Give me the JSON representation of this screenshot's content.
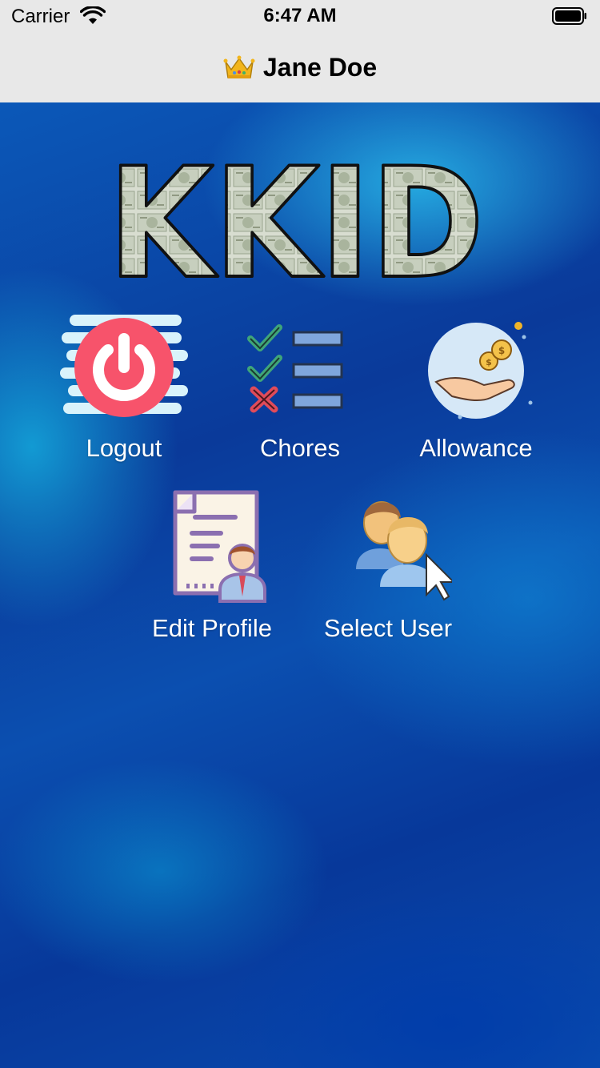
{
  "status_bar": {
    "carrier": "Carrier",
    "time": "6:47 AM"
  },
  "nav": {
    "icon": "crown-icon",
    "title": "Jane Doe"
  },
  "logo": {
    "text": "KKID"
  },
  "menu": [
    {
      "label": "Logout",
      "icon": "power-icon"
    },
    {
      "label": "Chores",
      "icon": "checklist-icon"
    },
    {
      "label": "Allowance",
      "icon": "coins-hand-icon"
    },
    {
      "label": "Edit Profile",
      "icon": "profile-document-icon"
    },
    {
      "label": "Select User",
      "icon": "users-pointer-icon"
    }
  ],
  "colors": {
    "nav_bg": "#e8e8e8",
    "background": "#0a3a9a",
    "power_red": "#f2516a",
    "check_green": "#3fa57a",
    "cross_red": "#e04b5a",
    "coin_gold": "#f0b429"
  }
}
